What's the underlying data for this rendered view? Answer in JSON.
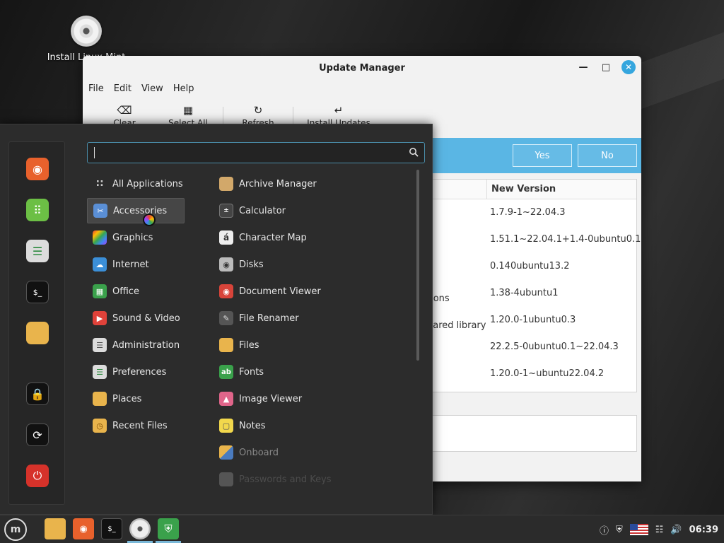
{
  "desktop": {
    "icon_label": "Install Linux Mint"
  },
  "update_manager": {
    "title": "Update Manager",
    "menu": [
      "File",
      "Edit",
      "View",
      "Help"
    ],
    "toolbar": {
      "clear": "Clear",
      "select_all": "Select All",
      "refresh": "Refresh",
      "install": "Install Updates"
    },
    "infobar": {
      "yes": "Yes",
      "no": "No"
    },
    "table": {
      "new_version_header": "New Version",
      "rows": [
        {
          "desc": "",
          "version": "1.7.9-1~22.04.3"
        },
        {
          "desc": "",
          "version": "1.51.1~22.04.1+1.4-0ubuntu0.1"
        },
        {
          "desc": "",
          "version": "0.140ubuntu13.2"
        },
        {
          "desc": "tions",
          "version": "1.38-4ubuntu1"
        },
        {
          "desc": "hared library",
          "version": "1.20.0-1ubuntu0.3"
        },
        {
          "desc": "",
          "version": "22.2.5-0ubuntu0.1~22.04.3"
        },
        {
          "desc": "",
          "version": "1.20.0-1~ubuntu22.04.2"
        }
      ]
    }
  },
  "menu": {
    "categories": [
      {
        "label": "All Applications",
        "icon": "grid-icon"
      },
      {
        "label": "Accessories",
        "icon": "scissors-icon"
      },
      {
        "label": "Graphics",
        "icon": "graphics-icon"
      },
      {
        "label": "Internet",
        "icon": "cloud-icon"
      },
      {
        "label": "Office",
        "icon": "office-icon"
      },
      {
        "label": "Sound & Video",
        "icon": "play-icon"
      },
      {
        "label": "Administration",
        "icon": "admin-icon"
      },
      {
        "label": "Preferences",
        "icon": "preferences-icon"
      },
      {
        "label": "Places",
        "icon": "folder-icon"
      },
      {
        "label": "Recent Files",
        "icon": "recent-files-icon"
      }
    ],
    "apps": [
      {
        "label": "Archive Manager",
        "icon": "archive-icon"
      },
      {
        "label": "Calculator",
        "icon": "calculator-icon"
      },
      {
        "label": "Character Map",
        "icon": "character-map-icon"
      },
      {
        "label": "Disks",
        "icon": "disks-icon"
      },
      {
        "label": "Document Viewer",
        "icon": "document-viewer-icon"
      },
      {
        "label": "File Renamer",
        "icon": "file-renamer-icon"
      },
      {
        "label": "Files",
        "icon": "folder-icon"
      },
      {
        "label": "Fonts",
        "icon": "fonts-icon"
      },
      {
        "label": "Image Viewer",
        "icon": "image-viewer-icon"
      },
      {
        "label": "Notes",
        "icon": "notes-icon"
      },
      {
        "label": "Onboard",
        "icon": "onboard-icon"
      },
      {
        "label": "Passwords and Keys",
        "icon": "passwords-icon"
      }
    ],
    "favorites": [
      "firefox-icon",
      "software-manager-icon",
      "settings-icon",
      "terminal-icon",
      "folder-icon",
      "lock-icon",
      "logout-icon",
      "power-icon"
    ]
  },
  "taskbar": {
    "clock": "06:39"
  }
}
